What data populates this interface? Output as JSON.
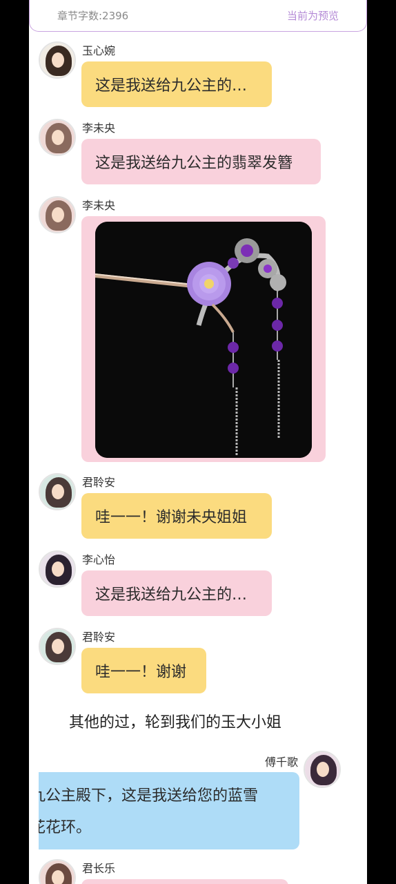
{
  "header": {
    "word_count": "章节字数:2396",
    "preview": "当前为预览"
  },
  "messages": [
    {
      "sender": "玉心婉",
      "text": "这是我送给九公主的…",
      "color": "#fbdb7f"
    },
    {
      "sender": "李未央",
      "text": "这是我送给九公主的翡翠发簪",
      "color": "#f9d1dc"
    },
    {
      "sender": "李未央",
      "image": "purple-flower-hairpin-image",
      "color": "#f9d1dc"
    },
    {
      "sender": "君聆安",
      "text": "哇一一！谢谢未央姐姐",
      "color": "#fbdb7f"
    },
    {
      "sender": "李心怡",
      "text": "这是我送给九公主的…",
      "color": "#f9d1dc"
    },
    {
      "sender": "君聆安",
      "text": "哇一一！谢谢",
      "color": "#fbdb7f"
    }
  ],
  "narration": "其他的过，轮到我们的玉大小姐",
  "right_message": {
    "sender": "傅千歌",
    "line1": "九公主殿下，这是我送给您的蓝雪",
    "line2": "花花环。",
    "color": "#aedcf7"
  },
  "last_message": {
    "sender": "君长乐"
  }
}
